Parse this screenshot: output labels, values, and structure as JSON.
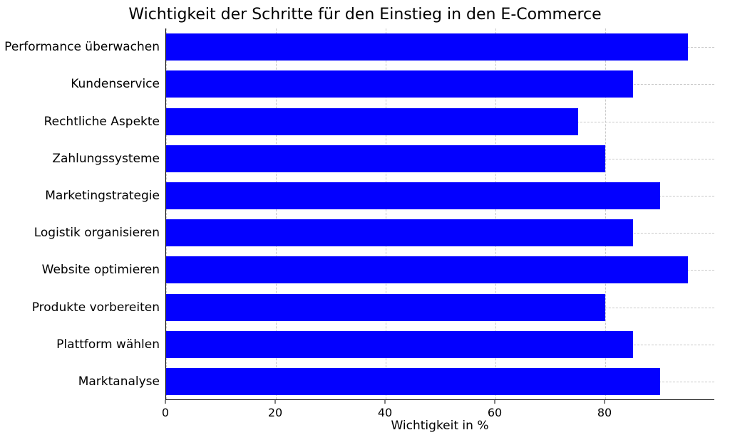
{
  "chart_data": {
    "type": "bar",
    "orientation": "horizontal",
    "title": "Wichtigkeit der Schritte für den Einstieg in den E-Commerce",
    "xlabel": "Wichtigkeit in %",
    "ylabel": "",
    "xlim": [
      0,
      100
    ],
    "x_ticks": [
      0,
      20,
      40,
      60,
      80
    ],
    "categories": [
      "Performance überwachen",
      "Kundenservice",
      "Rechtliche Aspekte",
      "Zahlungssysteme",
      "Marketingstrategie",
      "Logistik organisieren",
      "Website optimieren",
      "Produkte vorbereiten",
      "Plattform wählen",
      "Marktanalyse"
    ],
    "values": [
      95,
      85,
      75,
      80,
      90,
      85,
      95,
      80,
      85,
      90
    ],
    "bar_color": "#0300ff",
    "grid": "dashed"
  }
}
